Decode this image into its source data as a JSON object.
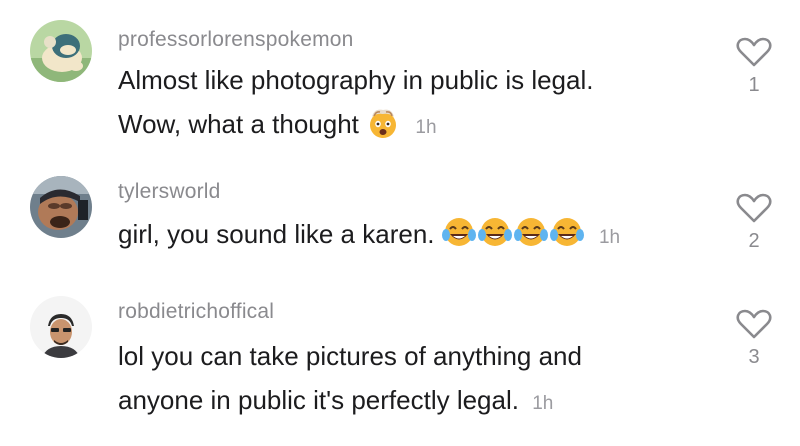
{
  "comments": [
    {
      "username": "professorlorenspokemon",
      "text_line1": "Almost like photography in public is legal.",
      "text_line2": "Wow, what a thought",
      "emoji": "exploding-head-emoji",
      "time": "1h",
      "likes": "1"
    },
    {
      "username": "tylersworld",
      "text": "girl, you sound like a karen.",
      "emoji": "tears-of-joy-emoji",
      "emoji_count": 4,
      "time": "1h",
      "likes": "2"
    },
    {
      "username": "robdietrichoffical",
      "text_line1": "lol you can take pictures of anything and",
      "text_line2": "anyone in public it's perfectly legal.",
      "time": "1h",
      "likes": "3"
    }
  ],
  "icons": {
    "like": "heart-outline-icon"
  },
  "colors": {
    "username": "#8a8a8e",
    "text": "#1c1c1e",
    "timestamp": "#9b9ba0",
    "icon": "#8a8a8e"
  }
}
